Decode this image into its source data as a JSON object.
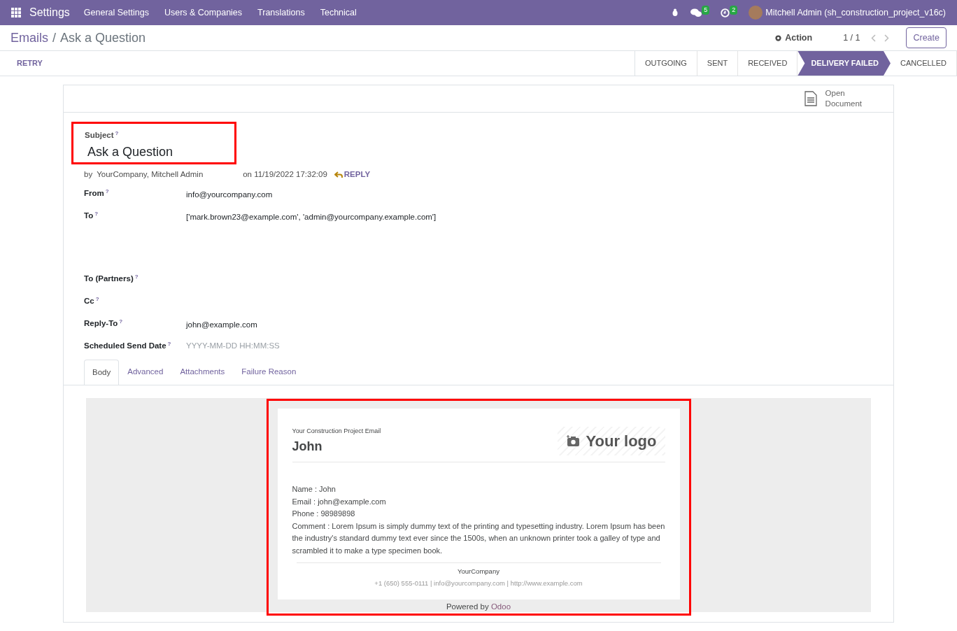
{
  "navbar": {
    "app": "Settings",
    "menus": [
      "General Settings",
      "Users & Companies",
      "Translations",
      "Technical"
    ],
    "messages_count": "5",
    "activities_count": "2",
    "user": "Mitchell Admin (sh_construction_project_v16c)"
  },
  "breadcrumb": {
    "parent": "Emails",
    "separator": "/",
    "current": "Ask a Question"
  },
  "control": {
    "action": "Action",
    "pager": "1 / 1",
    "create": "Create"
  },
  "header_button": "RETRY",
  "stages": [
    {
      "label": "OUTGOING",
      "selected": false
    },
    {
      "label": "SENT",
      "selected": false
    },
    {
      "label": "RECEIVED",
      "selected": false
    },
    {
      "label": "DELIVERY FAILED",
      "selected": true
    },
    {
      "label": "CANCELLED",
      "selected": false
    }
  ],
  "smart_button": {
    "line1": "Open",
    "line2": "Document"
  },
  "subject": {
    "label": "Subject",
    "help_mark": "?",
    "value": "Ask a Question",
    "highlighted": true
  },
  "meta": {
    "by": "by",
    "author": "YourCompany, Mitchell Admin",
    "date": "on 11/19/2022 17:32:09",
    "reply": "REPLY"
  },
  "fields": [
    {
      "label": "From",
      "help_mark": "?",
      "value": "info@yourcompany.com",
      "kind": "text"
    },
    {
      "label": "To",
      "help_mark": "?",
      "value": "['mark.brown23@example.com', 'admin@yourcompany.example.com']",
      "kind": "tall"
    },
    {
      "label": "To (Partners)",
      "help_mark": "?",
      "kind": "text"
    },
    {
      "label": "Cc",
      "help_mark": "?",
      "kind": "text"
    },
    {
      "label": "Reply-To",
      "help_mark": "?",
      "value": "john@example.com",
      "kind": "text"
    },
    {
      "label": "Scheduled Send Date",
      "help_mark": "?",
      "placeholder": "YYYY-MM-DD HH:MM:SS",
      "kind": "input"
    }
  ],
  "tabs": [
    {
      "label": "Body",
      "selected": true
    },
    {
      "label": "Advanced",
      "selected": false
    },
    {
      "label": "Attachments",
      "selected": false
    },
    {
      "label": "Failure Reason",
      "selected": false
    }
  ],
  "email_preview": {
    "highlighted": true,
    "kicker": "Your Construction Project Email",
    "name": "John",
    "logo_text": "Your logo",
    "lines": [
      "Name : John",
      "Email : john@example.com",
      "Phone : 98989898",
      "Comment : Lorem Ipsum is simply dummy text of the printing and typesetting industry. Lorem Ipsum has been the industry's standard dummy text ever since the 1500s, when an unknown printer took a galley of type and scrambled it to make a type specimen book."
    ],
    "company": "YourCompany",
    "contact": "+1 (650) 555-0111 | info@yourcompany.com | http://www.example.com",
    "powered_by": "Powered by",
    "powered_link": "Odoo"
  }
}
